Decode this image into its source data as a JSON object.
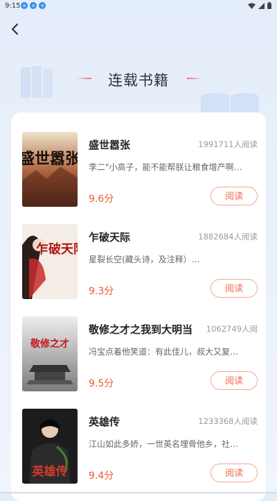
{
  "status_bar": {
    "time": "9:15",
    "notification_badges": [
      "a",
      "a",
      "a"
    ]
  },
  "header": {
    "title": "连载书籍"
  },
  "books": [
    {
      "title": "盛世嚣张",
      "readers": "1991711人阅读",
      "desc": "李二\"小高子，能不能帮朕让粮食增产啊…",
      "score": "9.6分",
      "read_label": "阅读",
      "cover_text": "盛世嚣张"
    },
    {
      "title": "乍破天际",
      "readers": "1882684人阅读",
      "desc": "星裂长空(藏头诗，及注释）…",
      "score": "9.3分",
      "read_label": "阅读",
      "cover_text": "乍破天际"
    },
    {
      "title": "敬修之才之我到大明当",
      "readers": "1062749人阅",
      "desc": "冯宝点着他笑道：有此佳儿，叔大又复…",
      "score": "9.5分",
      "read_label": "阅读",
      "cover_text": "敬修之才"
    },
    {
      "title": "英雄传",
      "readers": "1233368人阅读",
      "desc": "江山如此多娇，一世英名埋骨他乡，社…",
      "score": "9.4分",
      "read_label": "阅读",
      "cover_text": "英雄传"
    }
  ],
  "colors": {
    "accent": "#ee5a2a",
    "button_border": "#f5a58e",
    "background": "#e4edfa"
  },
  "icons": {
    "back": "chevron-left-icon",
    "wifi": "wifi-icon",
    "signal": "signal-icon",
    "battery": "battery-icon"
  }
}
